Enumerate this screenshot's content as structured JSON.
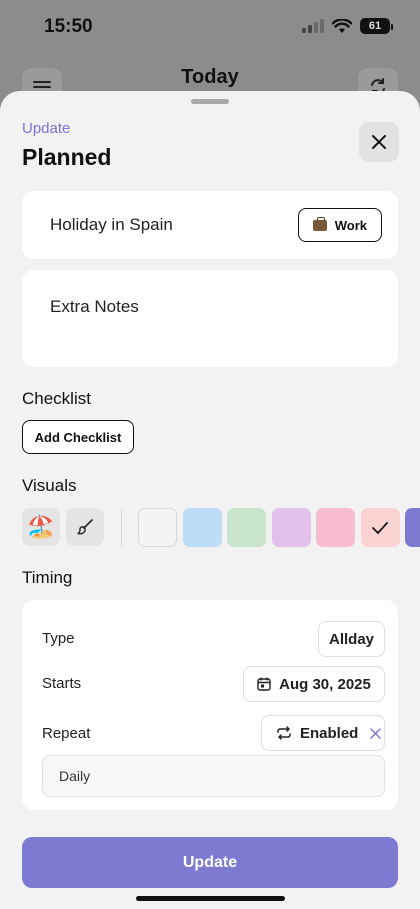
{
  "status_bar": {
    "time": "15:50",
    "battery": "61",
    "icons": [
      "cellular-signal-icon",
      "wifi-icon",
      "battery-icon"
    ]
  },
  "underlying_screen": {
    "title": "Today",
    "icons": [
      "menu-icon",
      "refresh-icon"
    ]
  },
  "sheet": {
    "subtitle": "Update",
    "title": "Planned",
    "close_icon": "close-icon"
  },
  "task": {
    "name": "Holiday in Spain",
    "category_label": "Work",
    "category_icon": "briefcase-icon",
    "notes_placeholder": "Extra Notes"
  },
  "checklist": {
    "heading": "Checklist",
    "add_label": "Add Checklist"
  },
  "visuals": {
    "heading": "Visuals",
    "emoji": "🏖️",
    "brush_icon": "paintbrush-icon",
    "colors": [
      "#f4f4f4",
      "#bcdcf7",
      "#c9e6cc",
      "#e2c2ea",
      "#f8bcd0",
      "#fbd2d2",
      "#7e7ad2"
    ],
    "selected_color_index": 5,
    "selected_icon": "checkmark-icon"
  },
  "timing": {
    "heading": "Timing",
    "type_label": "Type",
    "type_value": "Allday",
    "starts_label": "Starts",
    "starts_value": "Aug 30, 2025",
    "starts_icon": "calendar-icon",
    "repeat_label": "Repeat",
    "repeat_value": "Enabled",
    "repeat_icon": "repeat-icon",
    "repeat_clear_icon": "clear-icon",
    "frequency": "Daily"
  },
  "actions": {
    "update_label": "Update"
  },
  "accent_color": "#7e7ad2"
}
